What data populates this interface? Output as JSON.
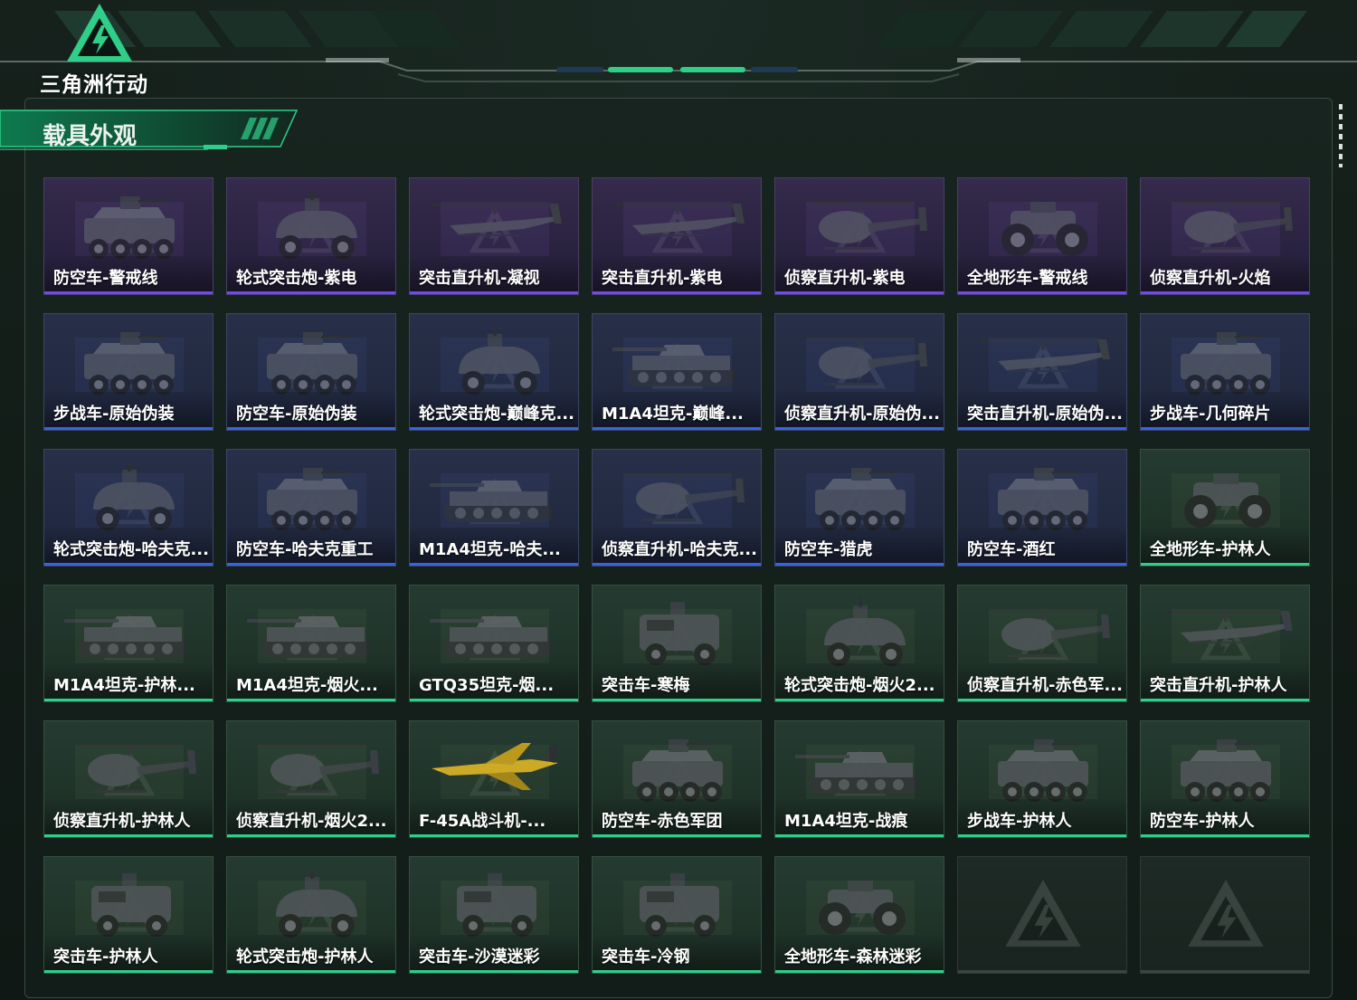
{
  "app": {
    "logo_text": "三角洲行动",
    "section_title": "载具外观"
  },
  "colors": {
    "accent": "#2fcf8a",
    "rarity_purple": "#6a4cf0",
    "rarity_blue": "#3a63e0",
    "rarity_green": "#2fcf8a",
    "background": "#0d1512"
  },
  "vehicles": [
    {
      "label": "防空车-警戒线",
      "rarity": "purple",
      "type": "apc"
    },
    {
      "label": "轮式突击炮-紫电",
      "rarity": "purple",
      "type": "armored-car"
    },
    {
      "label": "突击直升机-凝视",
      "rarity": "purple",
      "type": "attack-heli"
    },
    {
      "label": "突击直升机-紫电",
      "rarity": "purple",
      "type": "attack-heli"
    },
    {
      "label": "侦察直升机-紫电",
      "rarity": "purple",
      "type": "scout-heli"
    },
    {
      "label": "全地形车-警戒线",
      "rarity": "purple",
      "type": "atv"
    },
    {
      "label": "侦察直升机-火焰",
      "rarity": "purple",
      "type": "scout-heli"
    },
    {
      "label": "步战车-原始伪装",
      "rarity": "blue",
      "type": "apc"
    },
    {
      "label": "防空车-原始伪装",
      "rarity": "blue",
      "type": "apc"
    },
    {
      "label": "轮式突击炮-巅峰克...",
      "rarity": "blue",
      "type": "armored-car"
    },
    {
      "label": "M1A4坦克-巅峰...",
      "rarity": "blue",
      "type": "tank"
    },
    {
      "label": "侦察直升机-原始伪...",
      "rarity": "blue",
      "type": "scout-heli"
    },
    {
      "label": "突击直升机-原始伪...",
      "rarity": "blue",
      "type": "attack-heli"
    },
    {
      "label": "步战车-几何碎片",
      "rarity": "blue",
      "type": "apc"
    },
    {
      "label": "轮式突击炮-哈夫克...",
      "rarity": "blue",
      "type": "armored-car"
    },
    {
      "label": "防空车-哈夫克重工",
      "rarity": "blue",
      "type": "apc"
    },
    {
      "label": "M1A4坦克-哈夫...",
      "rarity": "blue",
      "type": "tank"
    },
    {
      "label": "侦察直升机-哈夫克...",
      "rarity": "blue",
      "type": "scout-heli"
    },
    {
      "label": "防空车-猎虎",
      "rarity": "blue",
      "type": "apc"
    },
    {
      "label": "防空车-酒红",
      "rarity": "blue",
      "type": "apc"
    },
    {
      "label": "全地形车-护林人",
      "rarity": "green",
      "type": "atv"
    },
    {
      "label": "M1A4坦克-护林...",
      "rarity": "green",
      "type": "tank"
    },
    {
      "label": "M1A4坦克-烟火...",
      "rarity": "green",
      "type": "tank"
    },
    {
      "label": "GTQ35坦克-烟...",
      "rarity": "green",
      "type": "tank"
    },
    {
      "label": "突击车-寒梅",
      "rarity": "green",
      "type": "mrap"
    },
    {
      "label": "轮式突击炮-烟火2...",
      "rarity": "green",
      "type": "armored-car"
    },
    {
      "label": "侦察直升机-赤色军...",
      "rarity": "green",
      "type": "scout-heli"
    },
    {
      "label": "突击直升机-护林人",
      "rarity": "green",
      "type": "attack-heli"
    },
    {
      "label": "侦察直升机-护林人",
      "rarity": "green",
      "type": "scout-heli"
    },
    {
      "label": "侦察直升机-烟火2...",
      "rarity": "green",
      "type": "scout-heli"
    },
    {
      "label": "F-45A战斗机-...",
      "rarity": "green",
      "type": "jet"
    },
    {
      "label": "防空车-赤色军团",
      "rarity": "green",
      "type": "apc"
    },
    {
      "label": "M1A4坦克-战痕",
      "rarity": "green",
      "type": "tank"
    },
    {
      "label": "步战车-护林人",
      "rarity": "green",
      "type": "apc"
    },
    {
      "label": "防空车-护林人",
      "rarity": "green",
      "type": "apc"
    },
    {
      "label": "突击车-护林人",
      "rarity": "green",
      "type": "mrap"
    },
    {
      "label": "轮式突击炮-护林人",
      "rarity": "green",
      "type": "armored-car"
    },
    {
      "label": "突击车-沙漠迷彩",
      "rarity": "green",
      "type": "mrap"
    },
    {
      "label": "突击车-冷钢",
      "rarity": "green",
      "type": "mrap"
    },
    {
      "label": "全地形车-森林迷彩",
      "rarity": "green",
      "type": "atv"
    },
    {
      "label": "",
      "rarity": "empty",
      "type": "empty"
    },
    {
      "label": "",
      "rarity": "empty",
      "type": "empty"
    }
  ]
}
